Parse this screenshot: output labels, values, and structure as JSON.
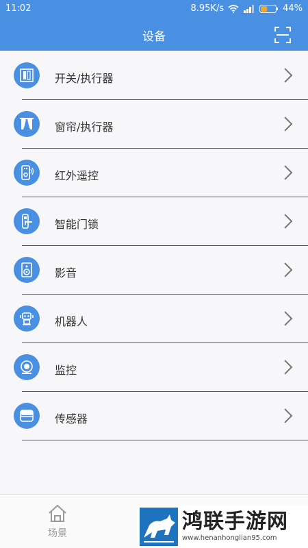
{
  "status": {
    "time": "11:02",
    "speed": "8.95K/s",
    "battery": "44%",
    "battery_level": 0.44
  },
  "header": {
    "title": "设备"
  },
  "device_list": [
    {
      "label": "开关/执行器",
      "icon": "switch-icon"
    },
    {
      "label": "窗帘/执行器",
      "icon": "curtain-icon"
    },
    {
      "label": "红外遥控",
      "icon": "remote-icon"
    },
    {
      "label": "智能门锁",
      "icon": "door-lock-icon"
    },
    {
      "label": "影音",
      "icon": "speaker-icon"
    },
    {
      "label": "机器人",
      "icon": "robot-icon"
    },
    {
      "label": "监控",
      "icon": "camera-icon"
    },
    {
      "label": "传感器",
      "icon": "sensor-icon"
    }
  ],
  "tabbar": {
    "scene_label": "场景"
  },
  "watermark": {
    "title": "鸿联手游网",
    "url": "www.henanhonglian95.com"
  },
  "colors": {
    "primary": "#4a90e2",
    "battery_fill": "#f5a623"
  }
}
